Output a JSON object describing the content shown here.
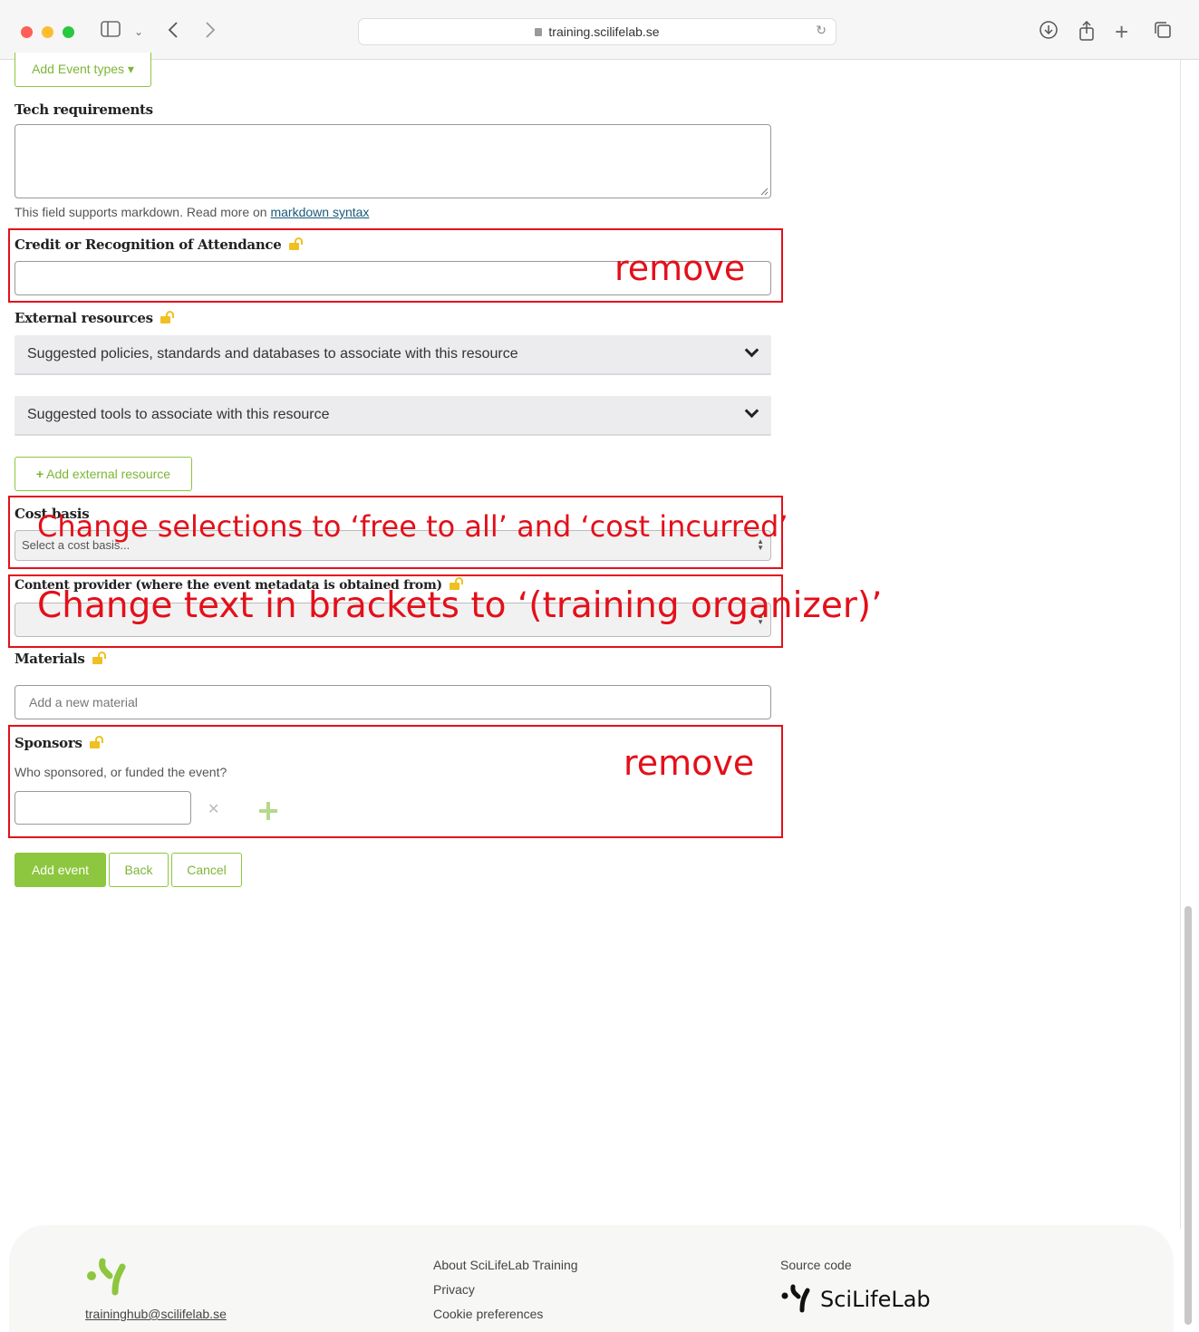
{
  "browser": {
    "url": "training.scilifelab.se"
  },
  "form": {
    "add_event_types": "Add Event types ▾",
    "tech_requirements": {
      "label": "Tech requirements",
      "hint_prefix": "This field supports markdown. Read more on ",
      "hint_link": "markdown syntax"
    },
    "credit": {
      "label": "Credit or Recognition of Attendance"
    },
    "external_resources": {
      "label": "External resources",
      "policies_panel": "Suggested policies, standards and databases to associate with this resource",
      "tools_panel": "Suggested tools to associate with this resource",
      "add_button": "Add external resource"
    },
    "cost_basis": {
      "label": "Cost basis",
      "selected": "Select a cost basis..."
    },
    "content_provider": {
      "label": "Content provider (where the event metadata is obtained from)",
      "selected": ""
    },
    "materials": {
      "label": "Materials",
      "placeholder": "Add a new material"
    },
    "sponsors": {
      "label": "Sponsors",
      "hint": "Who sponsored, or funded the event?"
    },
    "actions": {
      "add_event": "Add event",
      "back": "Back",
      "cancel": "Cancel"
    }
  },
  "annotations": {
    "remove_1": "remove",
    "cost_basis": "Change selections to ‘free to all’ and ‘cost incurred’",
    "content_provider": "Change text in brackets to ‘(training organizer)’",
    "remove_2": "remove"
  },
  "footer": {
    "email": "traininghub@scilifelab.se",
    "about": "About SciLifeLab Training",
    "privacy": "Privacy",
    "cookies": "Cookie preferences",
    "source_code": "Source code",
    "brand": "SciLifeLab"
  },
  "colors": {
    "accent": "#8dc63f",
    "annotation": "#e3101a",
    "unlock_icon": "#f0c020"
  }
}
